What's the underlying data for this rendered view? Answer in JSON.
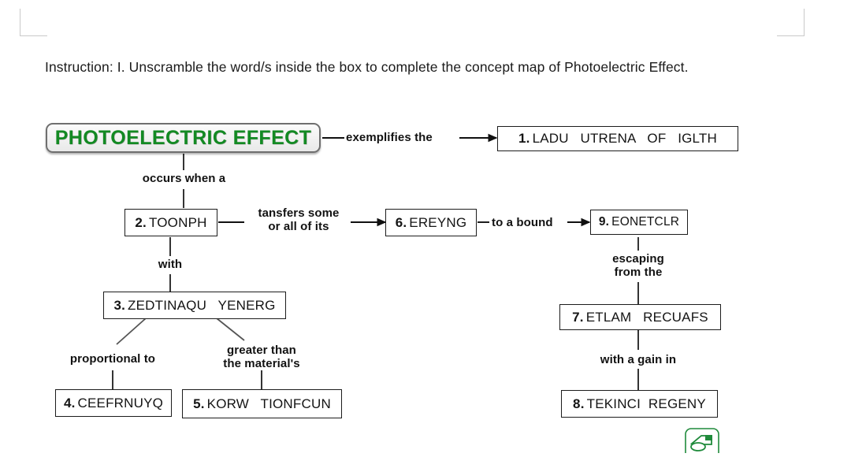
{
  "document": {
    "instruction": "Instruction: I. Unscramble the word/s inside the box to complete the concept map of Photoelectric Effect."
  },
  "concept_map": {
    "title_node": {
      "label": "PHOTOELECTRIC EFFECT",
      "color": "#138a23"
    },
    "nodes": [
      {
        "id": "n1",
        "num": "1.",
        "text": "LADU   UTRENA   OF   IGLTH"
      },
      {
        "id": "n2",
        "num": "2.",
        "text": "TOONPH"
      },
      {
        "id": "n3",
        "num": "3.",
        "text": "ZEDTINAQU   YENERG"
      },
      {
        "id": "n4",
        "num": "4.",
        "text": "CEEFRNUYQ"
      },
      {
        "id": "n5",
        "num": "5.",
        "text": "KORW   TIONFCUN"
      },
      {
        "id": "n6",
        "num": "6.",
        "text": "EREYNG"
      },
      {
        "id": "n7",
        "num": "7.",
        "text": "ETLAM   RECUAFS"
      },
      {
        "id": "n8",
        "num": "8.",
        "text": "TEKINCI  REGENY"
      },
      {
        "id": "n9",
        "num": "9.",
        "text": "EONETCLR"
      }
    ],
    "link_labels": [
      {
        "id": "l1",
        "text": "exemplifies the"
      },
      {
        "id": "l2",
        "text": "occurs when a"
      },
      {
        "id": "l3",
        "text": "tansfers some\nor all of its"
      },
      {
        "id": "l4",
        "text": "to a bound"
      },
      {
        "id": "l5",
        "text": "with"
      },
      {
        "id": "l6",
        "text": "escaping\nfrom the"
      },
      {
        "id": "l7",
        "text": "proportional to"
      },
      {
        "id": "l8",
        "text": "greater than\nthe material's"
      },
      {
        "id": "l9",
        "text": "with a gain in"
      }
    ]
  },
  "icons": {
    "device": "scanner-icon",
    "device_color": "#1f8a3b"
  }
}
